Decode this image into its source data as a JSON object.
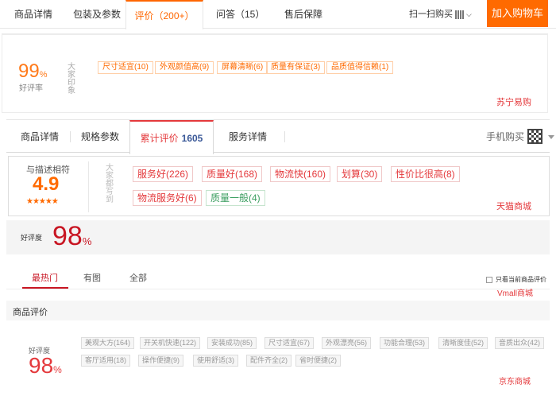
{
  "suning": {
    "tabs": [
      "商品详情",
      "包装及参数",
      "评价（200+）",
      "问答（15）",
      "售后保障"
    ],
    "scan_label": "扫一扫购买",
    "cart_button": "加入购物车",
    "rating_value": "99",
    "rating_unit": "%",
    "rating_label": "好评率",
    "impression_label": "大家印象",
    "tags": [
      "尺寸适宜(10)",
      "外观颜值高(9)",
      "屏幕清晰(6)",
      "质量有保证(3)",
      "品质值得信赖(1)"
    ],
    "brand": "苏宁易购"
  },
  "tmall": {
    "tabs": [
      "商品详情",
      "规格参数",
      "累计评价",
      "服务详情"
    ],
    "review_count": "1605",
    "phone_buy": "手机购买",
    "match_label": "与描述相符",
    "score": "4.9",
    "stars": "★★★★★",
    "impression_label": "大家都写到",
    "tags": [
      "服务好(226)",
      "质量好(168)",
      "物流快(160)",
      "划算(30)",
      "性价比很高(8)",
      "物流服务好(6)",
      "质量一般(4)"
    ],
    "brand": "天猫商城"
  },
  "vmall": {
    "rating_label": "好评度",
    "rating_value": "98",
    "rating_unit": "%",
    "tabs": [
      "最热门",
      "有图",
      "全部"
    ],
    "checkbox_label": "只看当前商品评价",
    "brand": "Vmall商城"
  },
  "jd": {
    "section_title": "商品评价",
    "rating_label": "好评度",
    "rating_value": "98",
    "rating_unit": "%",
    "tags": [
      "美观大方(164)",
      "开关机快速(122)",
      "安装成功(85)",
      "尺寸适宜(67)",
      "外观漂亮(56)",
      "功能合理(53)",
      "清晰度佳(52)",
      "音质出众(42)",
      "客厅适用(18)",
      "操作便捷(9)",
      "使用舒适(3)",
      "配件齐全(2)",
      "省时便捷(2)"
    ],
    "brand": "京东商城"
  },
  "colors": {
    "suning_orange": "#ff6a00",
    "tmall_red": "#e4393c",
    "jd_red": "#c81623",
    "tag_green": "#3a9e5f"
  }
}
